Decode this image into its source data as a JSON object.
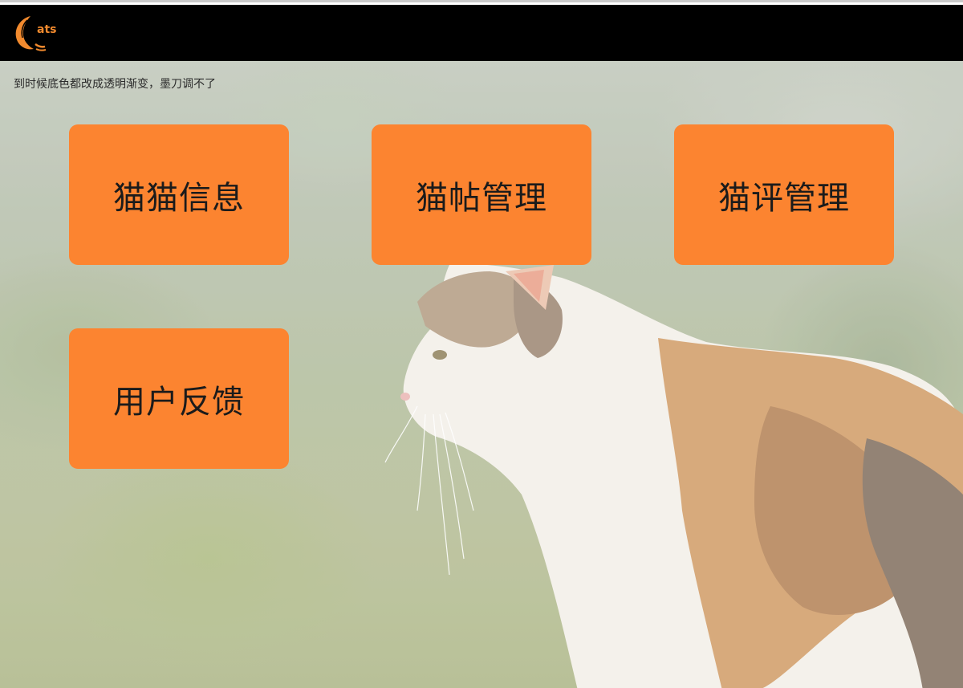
{
  "header": {
    "logo_text": "ats"
  },
  "note": "到时候底色都改成透明渐变，墨刀调不了",
  "menu": [
    {
      "label": "猫猫信息"
    },
    {
      "label": "猫帖管理"
    },
    {
      "label": "猫评管理"
    },
    {
      "label": "用户反馈"
    }
  ],
  "colors": {
    "header_bg": "#000000",
    "tile_bg": "#fc8430",
    "logo_orange": "#f28a2e",
    "tile_text": "#1b1b1b"
  },
  "icons": {
    "logo": "cats-logo-icon"
  }
}
